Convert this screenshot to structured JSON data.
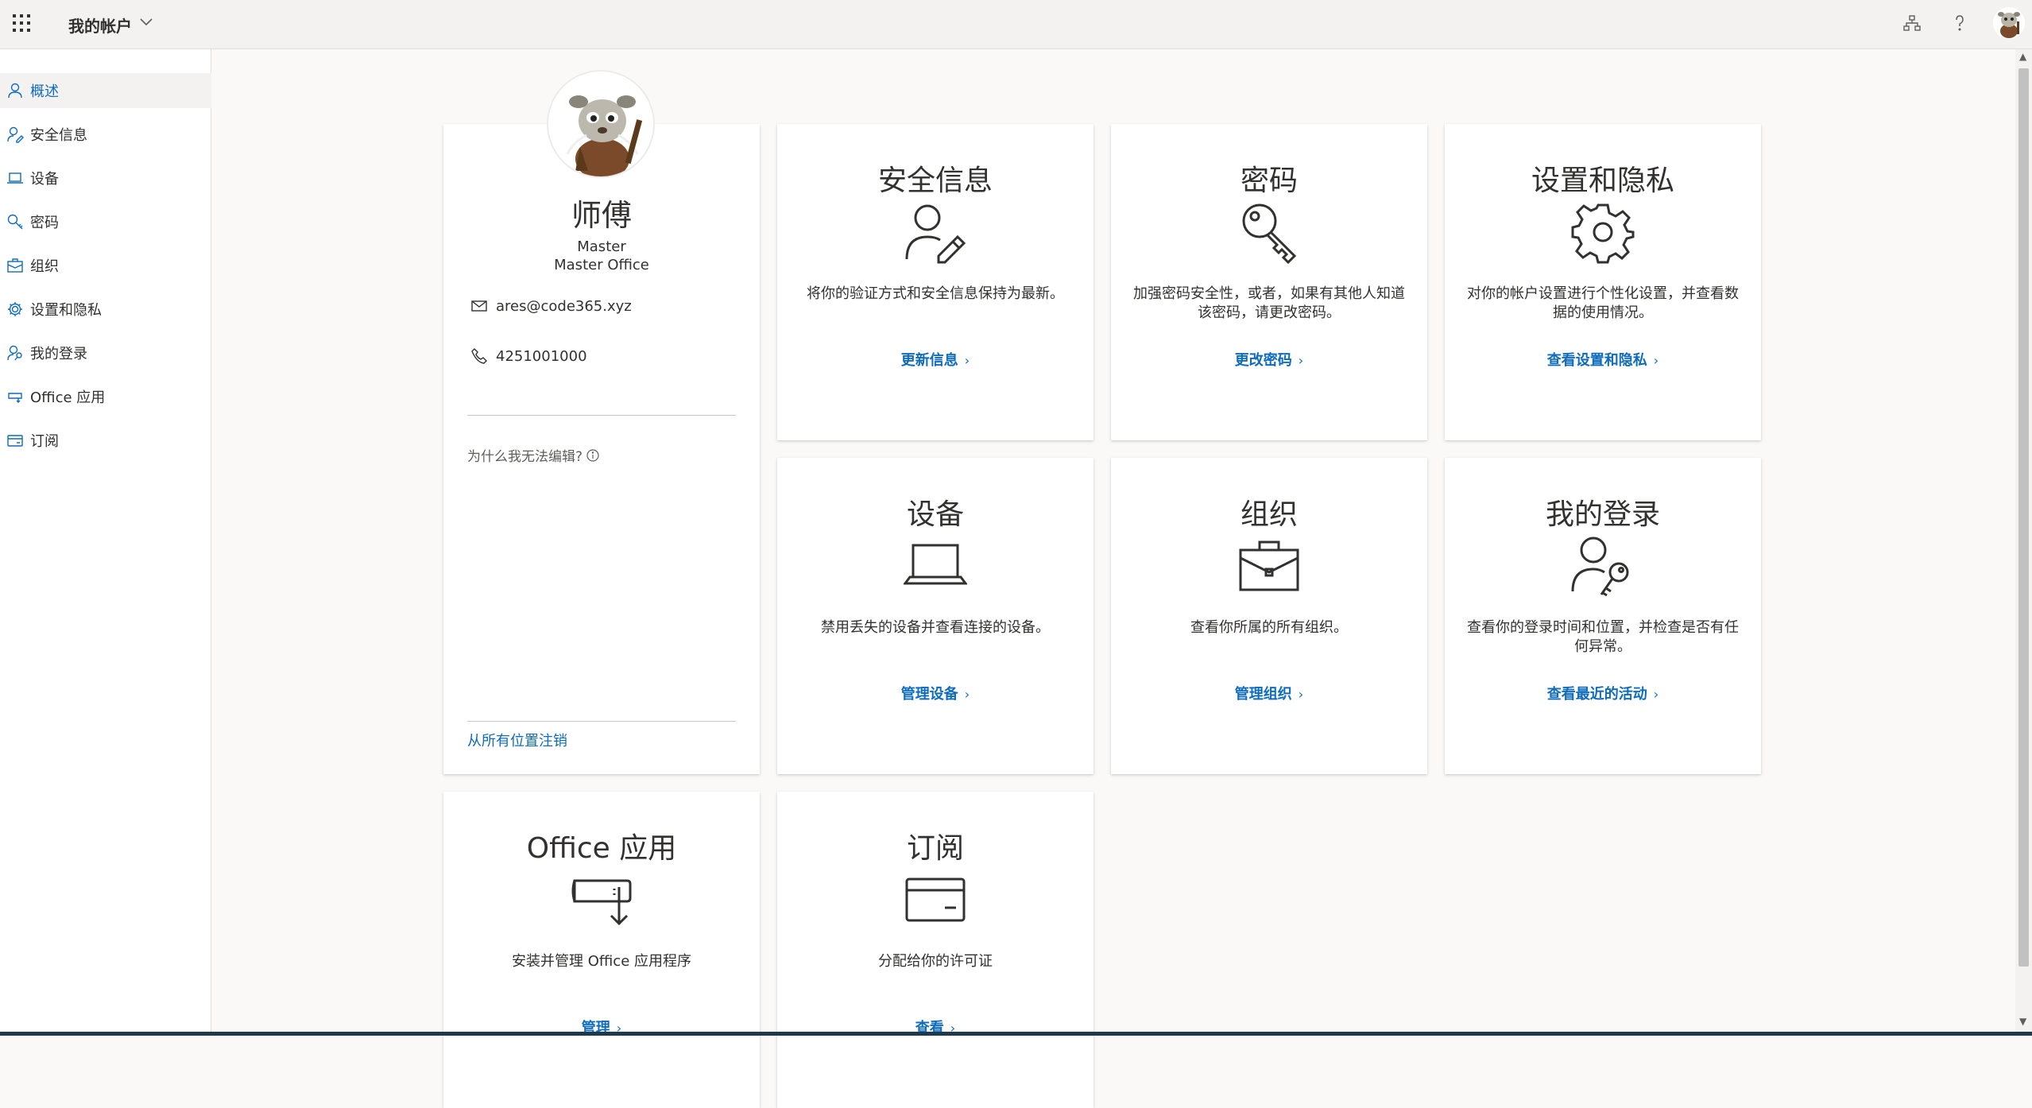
{
  "header": {
    "app_title": "我的帐户"
  },
  "sidebar": {
    "items": [
      {
        "label": "概述",
        "icon": "person-icon",
        "active": true
      },
      {
        "label": "安全信息",
        "icon": "security-info-icon"
      },
      {
        "label": "设备",
        "icon": "laptop-icon"
      },
      {
        "label": "密码",
        "icon": "key-icon"
      },
      {
        "label": "组织",
        "icon": "briefcase-icon"
      },
      {
        "label": "设置和隐私",
        "icon": "gear-icon"
      },
      {
        "label": "我的登录",
        "icon": "person-key-icon"
      },
      {
        "label": "Office 应用",
        "icon": "office-apps-icon"
      },
      {
        "label": "订阅",
        "icon": "card-icon"
      }
    ]
  },
  "profile": {
    "name": "师傅",
    "job_title": "Master",
    "department": "Master Office",
    "email": "ares@code365.xyz",
    "phone": "4251001000",
    "why_cant_edit": "为什么我无法编辑?",
    "sign_out_everywhere": "从所有位置注销"
  },
  "tiles": {
    "security": {
      "title": "安全信息",
      "desc": "将你的验证方式和安全信息保持为最新。",
      "link": "更新信息"
    },
    "password": {
      "title": "密码",
      "desc": "加强密码安全性，或者，如果有其他人知道该密码，请更改密码。",
      "link": "更改密码"
    },
    "settings": {
      "title": "设置和隐私",
      "desc": "对你的帐户设置进行个性化设置，并查看数据的使用情况。",
      "link": "查看设置和隐私"
    },
    "devices": {
      "title": "设备",
      "desc": "禁用丢失的设备并查看连接的设备。",
      "link": "管理设备"
    },
    "org": {
      "title": "组织",
      "desc": "查看你所属的所有组织。",
      "link": "管理组织"
    },
    "signins": {
      "title": "我的登录",
      "desc": "查看你的登录时间和位置，并检查是否有任何异常。",
      "link": "查看最近的活动"
    },
    "office": {
      "title": "Office 应用",
      "desc": "安装并管理 Office 应用程序",
      "link": "管理"
    },
    "subscriptions": {
      "title": "订阅",
      "desc": "分配给你的许可证",
      "link": "查看"
    }
  },
  "colors": {
    "accent": "#0f6cbd",
    "background": "#faf9f8",
    "card": "#ffffff"
  }
}
